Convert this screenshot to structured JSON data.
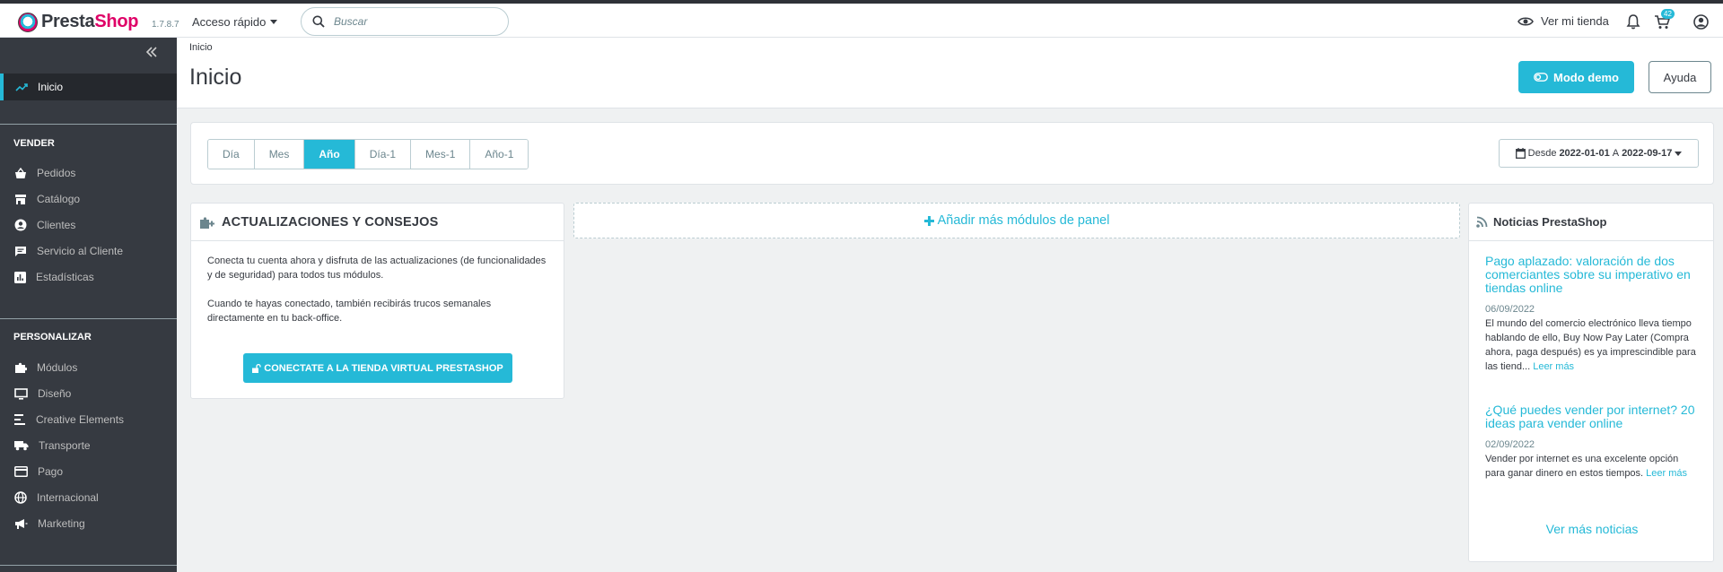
{
  "header": {
    "brand_presta": "Presta",
    "brand_shop": "Shop",
    "version": "1.7.8.7",
    "quick_access": "Acceso rápido",
    "search_placeholder": "Buscar",
    "view_store": "Ver mi tienda",
    "orders_badge": "42"
  },
  "sidebar": {
    "home": "Inicio",
    "sections": [
      {
        "title": "VENDER",
        "items": [
          "Pedidos",
          "Catálogo",
          "Clientes",
          "Servicio al Cliente",
          "Estadísticas"
        ]
      },
      {
        "title": "PERSONALIZAR",
        "items": [
          "Módulos",
          "Diseño",
          "Creative Elements",
          "Transporte",
          "Pago",
          "Internacional",
          "Marketing"
        ]
      }
    ]
  },
  "page": {
    "breadcrumb": "Inicio",
    "title": "Inicio",
    "demo_button": "Modo demo",
    "help_button": "Ayuda"
  },
  "filters": {
    "periods": [
      "Día",
      "Mes",
      "Año",
      "Día-1",
      "Mes-1",
      "Año-1"
    ],
    "active_period": "Año",
    "date_from_label": "Desde",
    "date_from": "2022-01-01",
    "date_to_label": "A",
    "date_to": "2022-09-17"
  },
  "updates": {
    "title": "ACTUALIZACIONES Y CONSEJOS",
    "paragraph1": "Conecta tu cuenta ahora y disfruta de las actualizaciones (de funcionalidades y de seguridad) para todos tus módulos.",
    "paragraph2": "Cuando te hayas conectado, también recibirás trucos semanales directamente en tu back-office.",
    "connect_button": "CONECTATE A LA TIENDA VIRTUAL PRESTASHOP"
  },
  "add_modules": "Añadir más módulos de panel",
  "news": {
    "title": "Noticias PrestaShop",
    "items": [
      {
        "title": "Pago aplazado: valoración de dos comerciantes sobre su imperativo en tiendas online",
        "date": "06/09/2022",
        "text": "El mundo del comercio electrónico lleva tiempo hablando de ello, Buy Now Pay Later (Compra ahora, paga después) es ya imprescindible para las tiend...",
        "read_more": "Leer más"
      },
      {
        "title": "¿Qué puedes vender por internet? 20 ideas para vender online",
        "date": "02/09/2022",
        "text": "Vender por internet es una excelente opción para ganar dinero en estos tiempos.",
        "read_more": "Leer más"
      }
    ],
    "more": "Ver más noticias"
  },
  "colors": {
    "accent": "#25b9d7",
    "brand_pink": "#df0067",
    "sidebar_bg": "#363a41",
    "sidebar_active_bg": "#25282d",
    "page_bg": "#eff1f2"
  }
}
